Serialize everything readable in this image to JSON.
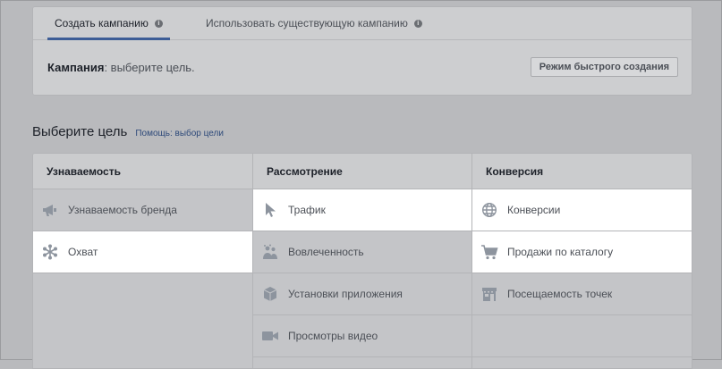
{
  "tabs": [
    {
      "label": "Создать кампанию",
      "active": true
    },
    {
      "label": "Использовать существующую кампанию",
      "active": false
    }
  ],
  "campaign": {
    "label": "Кампания",
    "text": ": выберите цель."
  },
  "quick_create_label": "Режим быстрого создания",
  "objective": {
    "title": "Выберите цель",
    "help_link": "Помощь: выбор цели"
  },
  "columns": [
    {
      "header": "Узнаваемость",
      "items": [
        {
          "label": "Узнаваемость бренда",
          "icon": "megaphone-icon",
          "selected": false
        },
        {
          "label": "Охват",
          "icon": "reach-burst-icon",
          "selected": true
        }
      ]
    },
    {
      "header": "Рассмотрение",
      "items": [
        {
          "label": "Трафик",
          "icon": "cursor-icon",
          "selected": true
        },
        {
          "label": "Вовлеченность",
          "icon": "people-icon",
          "selected": false
        },
        {
          "label": "Установки приложения",
          "icon": "box-icon",
          "selected": false
        },
        {
          "label": "Просмотры видео",
          "icon": "video-camera-icon",
          "selected": false
        }
      ]
    },
    {
      "header": "Конверсия",
      "items": [
        {
          "label": "Конверсии",
          "icon": "globe-icon",
          "selected": true
        },
        {
          "label": "Продажи по каталогу",
          "icon": "cart-icon",
          "selected": true
        },
        {
          "label": "Посещаемость точек",
          "icon": "store-icon",
          "selected": false
        }
      ]
    }
  ],
  "colors": {
    "accent": "#3d5d96",
    "link": "#2e4a7a",
    "icon": "#8d949e"
  }
}
